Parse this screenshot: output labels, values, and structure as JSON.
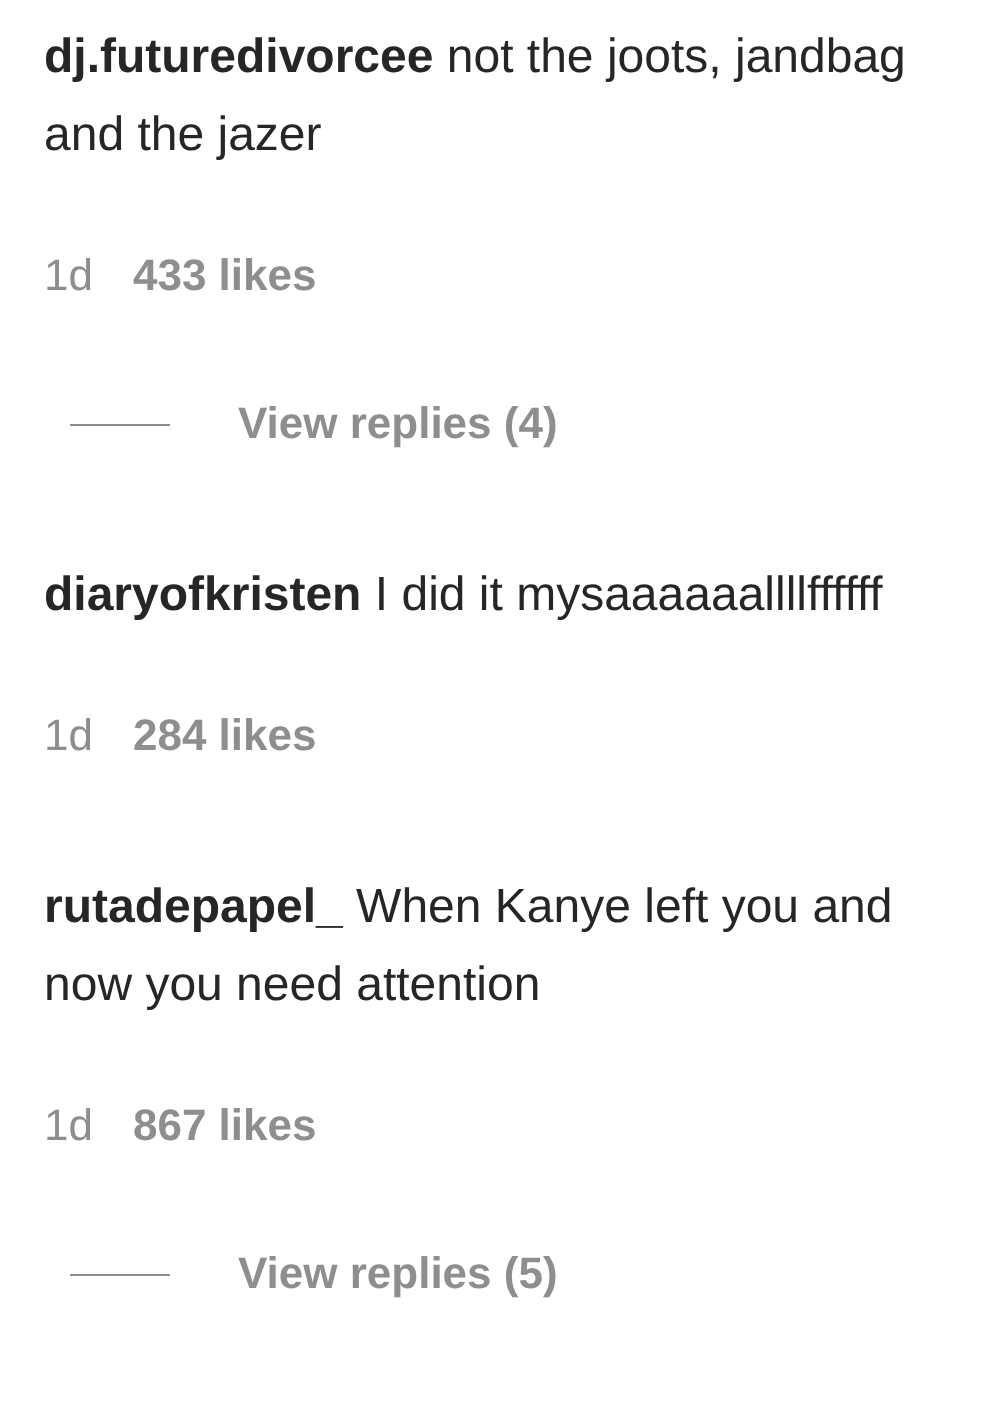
{
  "comments": [
    {
      "username": "dj.futuredivorcee",
      "text": "not the joots, jandbag and the jazer",
      "time": "1d",
      "likes": "433 likes",
      "view_replies": "View replies (4)"
    },
    {
      "username": "diaryofkristen",
      "text": "I did it mysaaaaaallllffffff",
      "time": "1d",
      "likes": "284 likes"
    },
    {
      "username": "rutadepapel_",
      "text": "When Kanye left you and now you need attention",
      "time": "1d",
      "likes": "867 likes",
      "view_replies": "View replies (5)"
    }
  ]
}
